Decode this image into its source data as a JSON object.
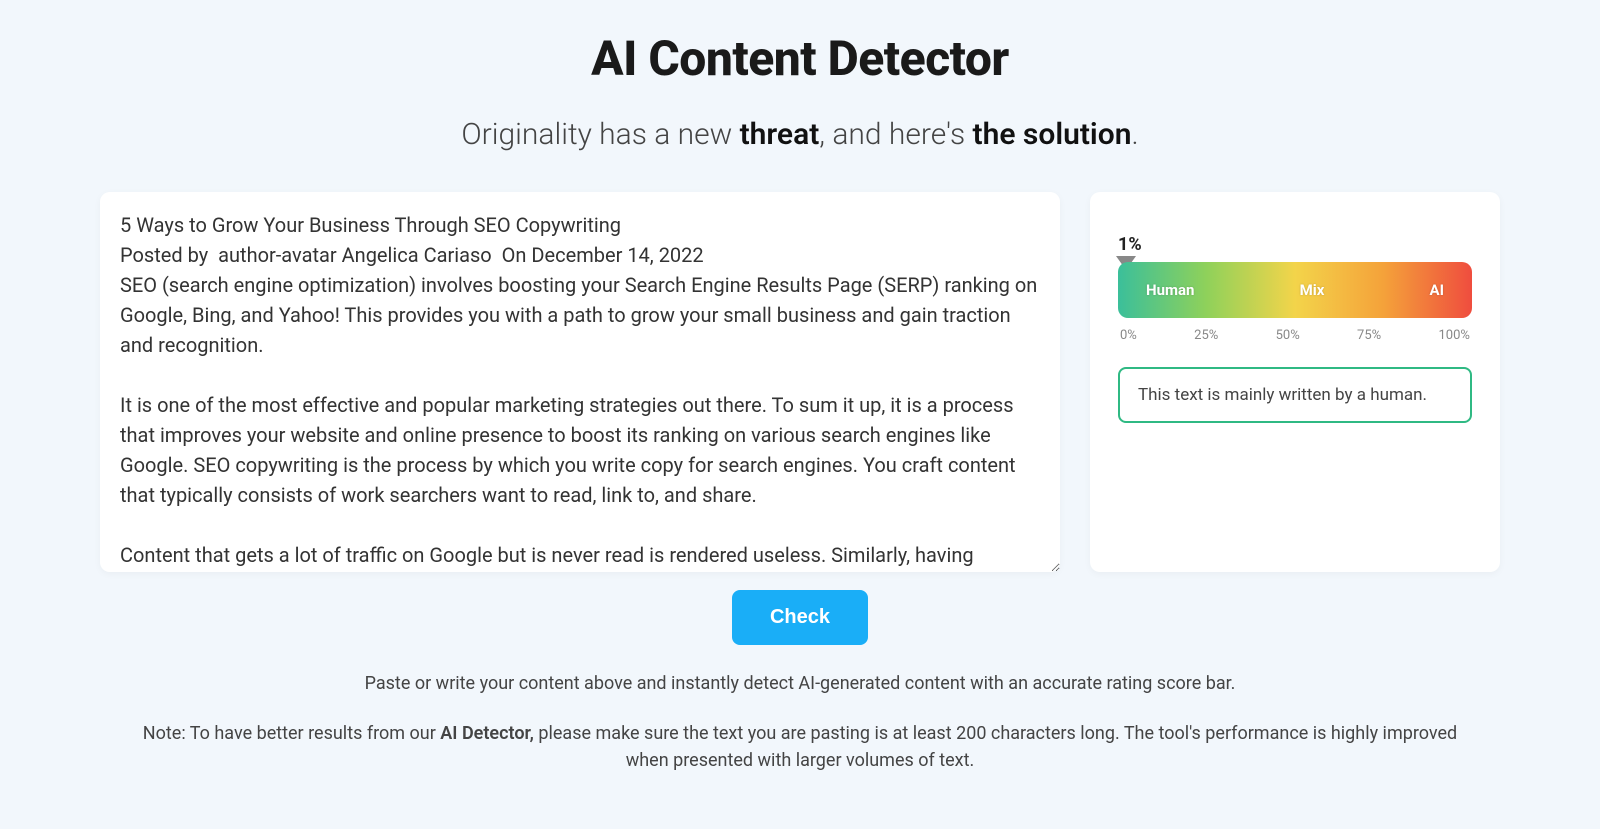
{
  "header": {
    "title": "AI Content Detector",
    "subtitle_pre": "Originality has a new ",
    "subtitle_bold1": "threat",
    "subtitle_mid": ", and here's ",
    "subtitle_bold2": "the solution",
    "subtitle_post": "."
  },
  "input": {
    "value": "5 Ways to Grow Your Business Through SEO Copywriting\nPosted by  author-avatar Angelica Cariaso  On December 14, 2022\nSEO (search engine optimization) involves boosting your Search Engine Results Page (SERP) ranking on Google, Bing, and Yahoo! This provides you with a path to grow your small business and gain traction and recognition.\n\nIt is one of the most effective and popular marketing strategies out there. To sum it up, it is a process that improves your website and online presence to boost its ranking on various search engines like Google. SEO copywriting is the process by which you write copy for search engines. You craft content that typically consists of work searchers want to read, link to, and share.\n\nContent that gets a lot of traffic on Google but is never read is rendered useless. Similarly, having content that is compelling but has low traffic is pointless because not many users have access to that incredibly persuasive piece of writing. That is where SEO comes in. If you still need"
  },
  "result": {
    "percent_label": "1%",
    "gauge_labels": {
      "left": "Human",
      "mid": "Mix",
      "right": "AI"
    },
    "ticks": [
      "0%",
      "25%",
      "50%",
      "75%",
      "100%"
    ],
    "verdict": "This text is mainly written by a human."
  },
  "actions": {
    "check_label": "Check"
  },
  "footer": {
    "instruction": "Paste or write your content above and instantly detect AI-generated content with an accurate rating score bar.",
    "note_pre": "Note: To have better results from our ",
    "note_bold": "AI Detector,",
    "note_post": " please make sure the text you are pasting is at least 200 characters long. The tool's performance is highly improved when presented with larger volumes of text."
  }
}
